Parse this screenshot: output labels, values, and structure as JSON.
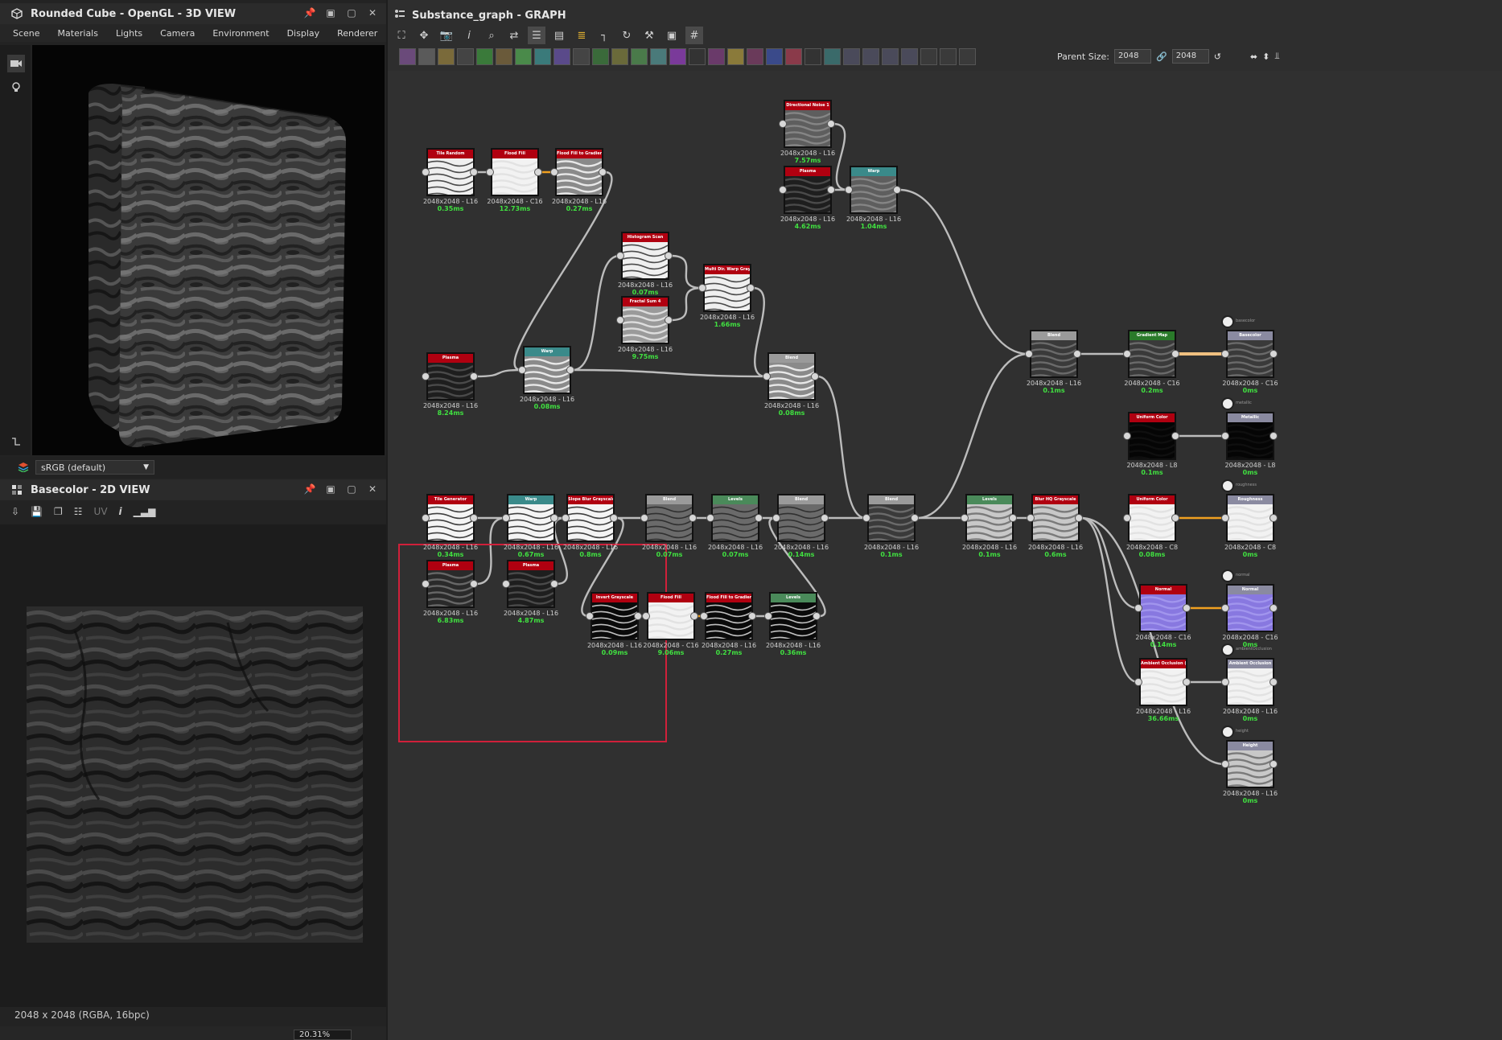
{
  "left_top": {
    "title": "Rounded Cube - OpenGL - 3D VIEW",
    "menu": [
      "Scene",
      "Materials",
      "Lights",
      "Camera",
      "Environment",
      "Display",
      "Renderer"
    ],
    "colorspace": "sRGB (default)"
  },
  "left_bottom": {
    "title": "Basecolor - 2D VIEW",
    "uv_label": "UV",
    "status": "2048 x 2048 (RGBA, 16bpc)",
    "zoom": "20.31%"
  },
  "graph": {
    "title": "Substance_graph - GRAPH",
    "parent_size_label": "Parent Size:",
    "parent_size_value": "2048",
    "size_value": "2048"
  },
  "nodes": [
    {
      "id": "n1",
      "title": "Tile Random",
      "color": "#b00010",
      "info": "2048x2048 - L16",
      "time": "0.35ms",
      "tex": "white-tiles"
    },
    {
      "id": "n2",
      "title": "Flood Fill",
      "color": "#b00010",
      "info": "2048x2048 - C16",
      "time": "12.73ms",
      "tex": "white"
    },
    {
      "id": "n3",
      "title": "Flood Fill to Gradient",
      "color": "#b00010",
      "info": "2048x2048 - L16",
      "time": "0.27ms",
      "tex": "gray-tiles"
    },
    {
      "id": "n4",
      "title": "Directional Noise 1",
      "color": "#b00010",
      "info": "2048x2048 - L16",
      "time": "7.57ms",
      "tex": "rock"
    },
    {
      "id": "n5",
      "title": "Plasma",
      "color": "#b00010",
      "info": "2048x2048 - L16",
      "time": "4.62ms",
      "tex": "dark"
    },
    {
      "id": "n6",
      "title": "Warp",
      "color": "#3a8a8a",
      "info": "2048x2048 - L16",
      "time": "1.04ms",
      "tex": "rock"
    },
    {
      "id": "n7",
      "title": "Histogram Scan",
      "color": "#b00010",
      "info": "2048x2048 - L16",
      "time": "0.07ms",
      "tex": "white-tiles"
    },
    {
      "id": "n8",
      "title": "Multi Dir. Warp Grayscale",
      "color": "#b00010",
      "info": "2048x2048 - L16",
      "time": "1.66ms",
      "tex": "white-tiles"
    },
    {
      "id": "n9",
      "title": "Fractal Sum 4",
      "color": "#b00010",
      "info": "2048x2048 - L16",
      "time": "9.75ms",
      "tex": "noise"
    },
    {
      "id": "n10",
      "title": "Plasma",
      "color": "#b00010",
      "info": "2048x2048 - L16",
      "time": "8.24ms",
      "tex": "dark"
    },
    {
      "id": "n11",
      "title": "Warp",
      "color": "#3a8a8a",
      "info": "2048x2048 - L16",
      "time": "0.08ms",
      "tex": "gray-tiles"
    },
    {
      "id": "n12",
      "title": "Blend",
      "color": "#9a9a9a",
      "info": "2048x2048 - L16",
      "time": "0.08ms",
      "tex": "gray-tiles"
    },
    {
      "id": "n13",
      "title": "Blend",
      "color": "#9a9a9a",
      "info": "2048x2048 - L16",
      "time": "0.1ms",
      "tex": "rock-dark"
    },
    {
      "id": "n14",
      "title": "Gradient Map",
      "color": "#2a7a2a",
      "info": "2048x2048 - C16",
      "time": "0.2ms",
      "tex": "rock-dark"
    },
    {
      "id": "n15",
      "title": "Basecolor",
      "color": "#8a8aa0",
      "info": "2048x2048 - C16",
      "time": "0ms",
      "tex": "rock-dark"
    },
    {
      "id": "n16",
      "title": "Uniform Color",
      "color": "#b00010",
      "info": "2048x2048 - L8",
      "time": "0.1ms",
      "tex": "black"
    },
    {
      "id": "n17",
      "title": "Metallic",
      "color": "#8a8aa0",
      "info": "2048x2048 - L8",
      "time": "0ms",
      "tex": "black"
    },
    {
      "id": "n18",
      "title": "Tile Generator",
      "color": "#b00010",
      "info": "2048x2048 - L16",
      "time": "0.34ms",
      "tex": "cracks"
    },
    {
      "id": "n19",
      "title": "Warp",
      "color": "#3a8a8a",
      "info": "2048x2048 - L16",
      "time": "0.67ms",
      "tex": "cracks"
    },
    {
      "id": "n20",
      "title": "Slope Blur Grayscale",
      "color": "#b00010",
      "info": "2048x2048 - L16",
      "time": "0.8ms",
      "tex": "cracks"
    },
    {
      "id": "n21",
      "title": "Blend",
      "color": "#9a9a9a",
      "info": "2048x2048 - L16",
      "time": "0.07ms",
      "tex": "gray-cracks"
    },
    {
      "id": "n22",
      "title": "Levels",
      "color": "#4a8a5a",
      "info": "2048x2048 - L16",
      "time": "0.07ms",
      "tex": "gray-cracks"
    },
    {
      "id": "n23",
      "title": "Blend",
      "color": "#9a9a9a",
      "info": "2048x2048 - L16",
      "time": "0.14ms",
      "tex": "gray-cracks"
    },
    {
      "id": "n24",
      "title": "Blend",
      "color": "#9a9a9a",
      "info": "2048x2048 - L16",
      "time": "0.1ms",
      "tex": "rock-dark"
    },
    {
      "id": "n25",
      "title": "Levels",
      "color": "#4a8a5a",
      "info": "2048x2048 - L16",
      "time": "0.1ms",
      "tex": "light-rock"
    },
    {
      "id": "n26",
      "title": "Blur HQ Grayscale",
      "color": "#b00010",
      "info": "2048x2048 - L16",
      "time": "0.6ms",
      "tex": "light-rock"
    },
    {
      "id": "n27",
      "title": "Uniform Color",
      "color": "#b00010",
      "info": "2048x2048 - C8",
      "time": "0.08ms",
      "tex": "white"
    },
    {
      "id": "n28",
      "title": "Roughness",
      "color": "#8a8aa0",
      "info": "2048x2048 - C8",
      "time": "0ms",
      "tex": "white"
    },
    {
      "id": "n29",
      "title": "Plasma",
      "color": "#b00010",
      "info": "2048x2048 - L16",
      "time": "6.83ms",
      "tex": "plasma"
    },
    {
      "id": "n30",
      "title": "Plasma",
      "color": "#b00010",
      "info": "2048x2048 - L16",
      "time": "4.87ms",
      "tex": "dark"
    },
    {
      "id": "n31",
      "title": "Invert Grayscale",
      "color": "#b00010",
      "info": "2048x2048 - L16",
      "time": "0.09ms",
      "tex": "black-cracks"
    },
    {
      "id": "n32",
      "title": "Flood Fill",
      "color": "#b00010",
      "info": "2048x2048 - C16",
      "time": "9.06ms",
      "tex": "white"
    },
    {
      "id": "n33",
      "title": "Flood Fill to Gradient",
      "color": "#b00010",
      "info": "2048x2048 - L16",
      "time": "0.27ms",
      "tex": "black-cracks"
    },
    {
      "id": "n34",
      "title": "Levels",
      "color": "#4a8a5a",
      "info": "2048x2048 - L16",
      "time": "0.36ms",
      "tex": "black-cracks"
    },
    {
      "id": "n35",
      "title": "Normal",
      "color": "#b00010",
      "info": "2048x2048 - C16",
      "time": "0.14ms",
      "tex": "normal"
    },
    {
      "id": "n36",
      "title": "Normal",
      "color": "#8a8aa0",
      "info": "2048x2048 - C16",
      "time": "0ms",
      "tex": "normal"
    },
    {
      "id": "n37",
      "title": "Ambient Occlusion (HB...",
      "color": "#b00010",
      "info": "2048x2048 - L16",
      "time": "36.66ms",
      "tex": "white"
    },
    {
      "id": "n38",
      "title": "Ambient Occlusion",
      "color": "#8a8aa0",
      "info": "2048x2048 - L16",
      "time": "0ms",
      "tex": "white"
    },
    {
      "id": "n39",
      "title": "Height",
      "color": "#8a8aa0",
      "info": "2048x2048 - L16",
      "time": "0ms",
      "tex": "light-rock"
    }
  ],
  "output_labels": [
    "basecolor",
    "metallic",
    "roughness",
    "normal",
    "ambientOcclusion",
    "height"
  ]
}
